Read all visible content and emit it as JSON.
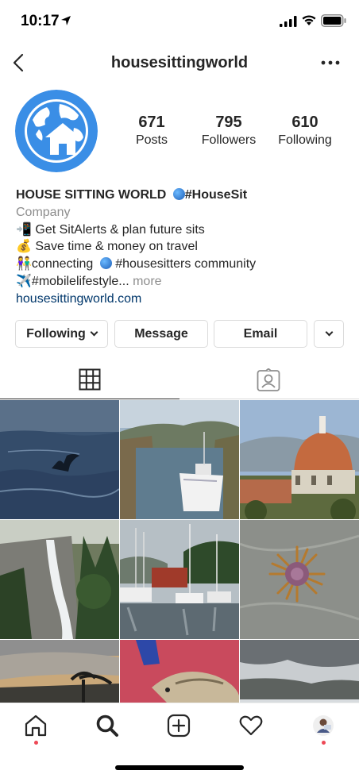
{
  "status_bar": {
    "time": "10:17"
  },
  "header": {
    "username": "housesittingworld"
  },
  "profile": {
    "stats": {
      "posts": {
        "value": "671",
        "label": "Posts"
      },
      "followers": {
        "value": "795",
        "label": "Followers"
      },
      "following": {
        "value": "610",
        "label": "Following"
      }
    }
  },
  "bio": {
    "name": "HOUSE SITTING WORLD",
    "name_tag": "#HouseSit",
    "category": "Company",
    "line1": "📲 Get SitAlerts & plan future sits",
    "line2": "💰 Save time & money on travel",
    "line3a": "👫connecting",
    "line3b": "#housesitters community",
    "line4": "✈️#mobilelifestyle...",
    "more": "more",
    "website": "housesittingworld.com"
  },
  "buttons": {
    "following": "Following",
    "message": "Message",
    "email": "Email"
  },
  "tabs": {
    "active": "grid",
    "items": [
      "grid",
      "tagged"
    ]
  },
  "grid": {
    "photos": [
      "whale-tail",
      "harbor-boat",
      "florence-duomo",
      "waterfall",
      "marina",
      "jellyfish",
      "sunset-palm",
      "fish",
      "cloudy-sky"
    ]
  },
  "bottom_nav": {
    "items": [
      "home",
      "search",
      "new-post",
      "activity",
      "profile"
    ],
    "active": "search"
  },
  "colors": {
    "text": "#262626",
    "secondary": "#8e8e8e",
    "link": "#00376b",
    "border": "#dbdbdb",
    "notification": "#ed4956",
    "avatar_blue": "#3a8ee6"
  }
}
